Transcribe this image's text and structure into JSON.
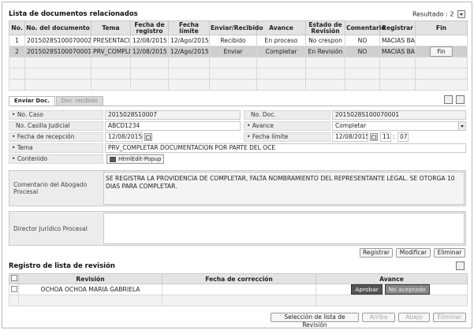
{
  "list_section": {
    "title": "Lista de documentos relacionados",
    "result_label": "Resultado : 2",
    "columns": [
      "No.",
      "No. del documento",
      "Tema",
      "Fecha de registro",
      "Fecha límite",
      "Enviar/Recibido",
      "Avance",
      "Estado de Revisión",
      "Comentario",
      "Registrar",
      "Fin"
    ],
    "rows": [
      [
        "1",
        "2015028S100070002",
        "PRESENTACIC",
        "12/08/2015",
        "12/Ago/2015",
        "Recibido",
        "En proceso",
        "No crespon",
        "NO",
        "MACIAS BAI",
        ""
      ],
      [
        "2",
        "2015028S100070001",
        "PRV_COMPLET",
        "12/08/2015",
        "12/Ago/2015",
        "Enviar",
        "Completar",
        "En Revisión",
        "NO",
        "MACIAS BAI",
        "Fin"
      ]
    ]
  },
  "tabs": [
    "Enviar Doc.",
    "Doc. recibido"
  ],
  "form": {
    "no_caso_label": "No. Caso",
    "no_caso_value": "2015028S10007",
    "no_doc_label": "No. Doc.",
    "no_doc_value": "2015028S100070001",
    "casilla_label": "No. Casilla Judicial",
    "casilla_value": "ABCD1234",
    "avance_label": "Avance",
    "avance_value": "Completar",
    "fecha_recepcion_label": "Fecha de recepción",
    "fecha_recepcion_value": "12/08/2015",
    "fecha_limite_label": "Fecha límite",
    "fecha_limite_value": "12/08/2015",
    "hour_value": "11",
    "minute_value": "07",
    "tema_label": "Tema",
    "tema_value": "PRV_COMPLETAR DOCUMENTACION POR PARTE DEL OCE",
    "contenido_label": "Contenido",
    "contenido_button": "HtmlEdit-Popup",
    "comentario_label": "Comentario del Abogado Procesal",
    "comentario_value": "SE REGISTRA LA PROVIDENCIA DE COMPLETAR, FALTA NOMBRAMIENTO DEL REPRESENTANTE LEGAL. SE OTORGA 10 DIAS PARA COMPLETAR.",
    "director_label": "Director Jurídico Procesal",
    "director_value": ""
  },
  "form_buttons": {
    "registrar": "Registrar",
    "modificar": "Modificar",
    "eliminar": "Eliminar"
  },
  "revision_section": {
    "title": "Registro de lista de revisión",
    "columns": [
      "Revisión",
      "Fecha de corrección",
      "Avance"
    ],
    "rows": [
      {
        "revision": "OCHOA OCHOA MARIA GABRIELA",
        "fecha": "",
        "aprobar": "Aprobar",
        "no_aceptado": "No aceptado"
      }
    ]
  },
  "bottom_buttons": {
    "seleccion": "Selección de lista de Revisión",
    "arriba": "Arriba",
    "abajo": "Abajo",
    "eliminar": "Eliminar"
  }
}
